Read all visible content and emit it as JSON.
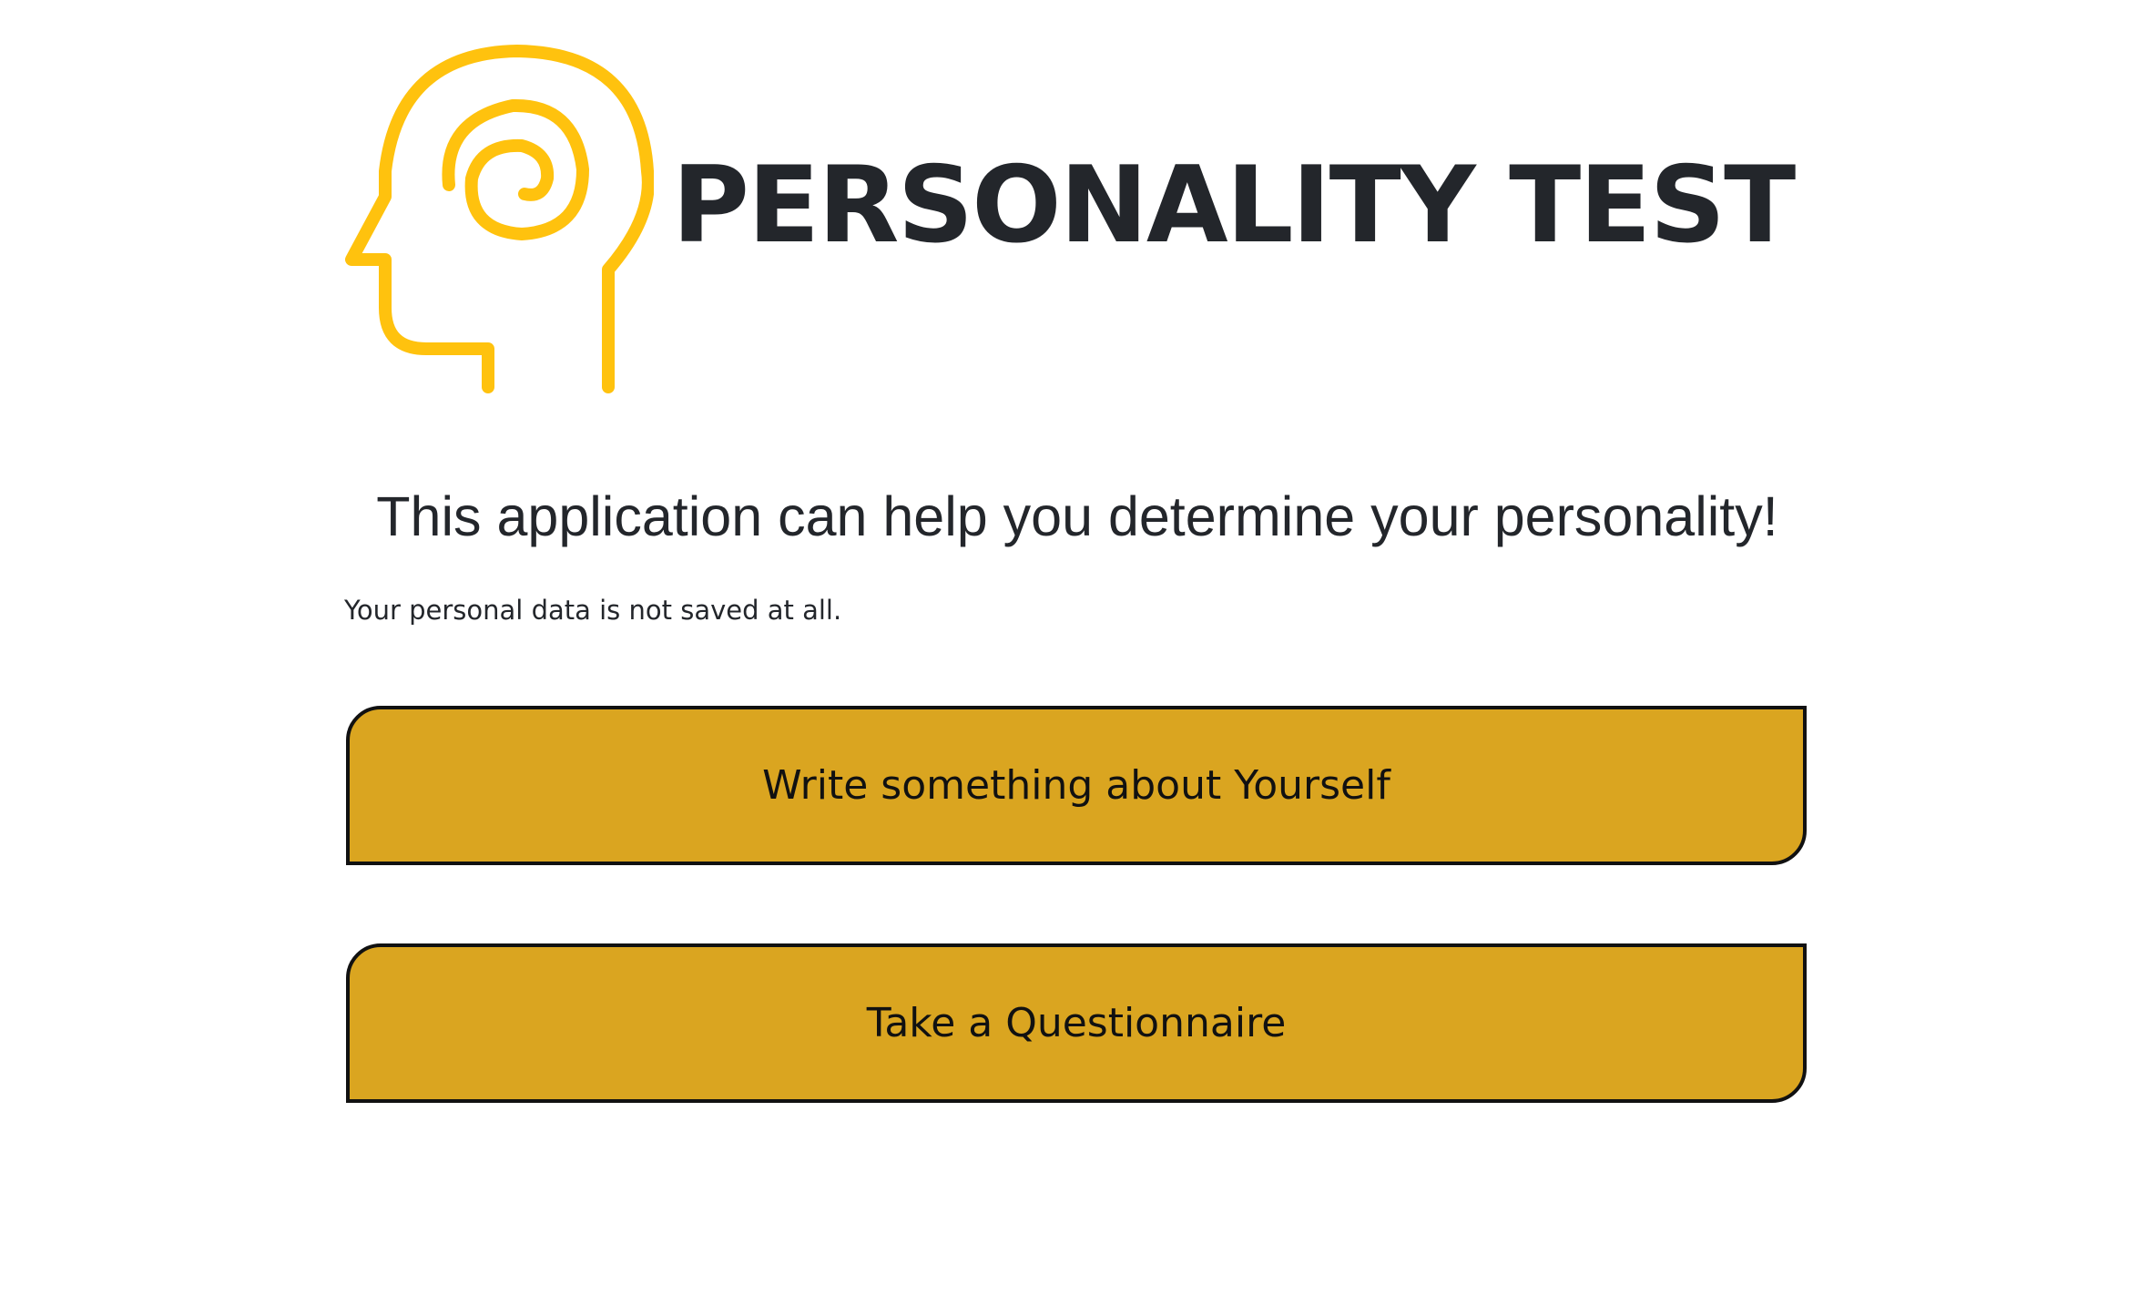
{
  "logo": {
    "icon": "head-spiral-icon",
    "wordmark": "PERSONALITY TEST",
    "icon_color": "#FFC20E",
    "wordmark_color": "#23262B"
  },
  "intro": {
    "headline": "This application can help you determine your personality!",
    "privacy_note": "Your personal data is not saved at all."
  },
  "actions": {
    "write_label": "Write something about Yourself",
    "questionnaire_label": "Take a Questionnaire",
    "button_color": "#DAA520",
    "border_color": "#111111"
  }
}
